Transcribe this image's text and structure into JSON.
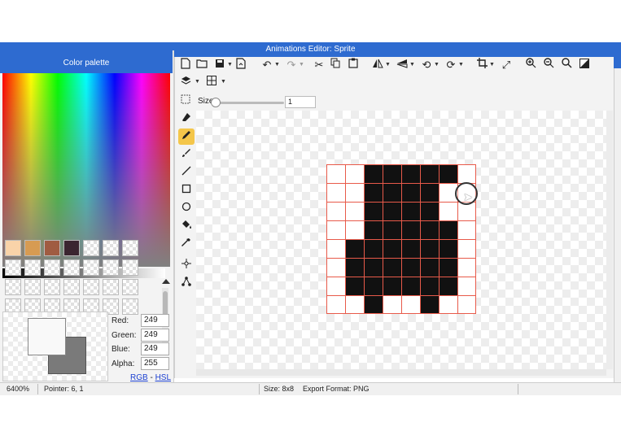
{
  "window": {
    "title": "Animations Editor: Sprite"
  },
  "palette": {
    "title": "Color palette",
    "swatch_colors": [
      "#f9d3a9",
      "#d79b52",
      "#a05c42",
      "#3b2530"
    ]
  },
  "color_values": {
    "red_label": "Red:",
    "red": "249",
    "green_label": "Green:",
    "green": "249",
    "blue_label": "Blue:",
    "blue": "249",
    "alpha_label": "Alpha:",
    "alpha": "255",
    "mode_rgb": "RGB",
    "mode_sep": " - ",
    "mode_hsl": "HSL"
  },
  "toolbar": {
    "icons_row1": [
      "new-file-icon",
      "open-folder-icon",
      "save-icon",
      "export-icon",
      "undo-icon",
      "redo-icon",
      "cut-icon",
      "copy-icon",
      "paste-icon",
      "flip-horizontal-icon",
      "flip-vertical-icon",
      "rotate-left-icon",
      "rotate-right-icon",
      "crop-icon",
      "resize-icon",
      "zoom-in-icon",
      "zoom-out-icon",
      "zoom-fit-icon",
      "invert-icon"
    ],
    "icons_row2": [
      "layers-icon",
      "grid-icon"
    ],
    "size_label": "Size",
    "size_value": "1"
  },
  "tools": [
    "select-tool-icon",
    "eraser-icon",
    "pencil-icon",
    "brush-icon",
    "line-icon",
    "rectangle-icon",
    "ellipse-icon",
    "fill-bucket-icon",
    "eyedropper-icon",
    "move-point-icon",
    "node-tool-icon"
  ],
  "sprite": {
    "width": 8,
    "height": 8,
    "pixels": [
      [
        0,
        0,
        1,
        1,
        1,
        1,
        1,
        0
      ],
      [
        0,
        0,
        1,
        1,
        1,
        1,
        0,
        0
      ],
      [
        0,
        0,
        1,
        1,
        1,
        1,
        0,
        0
      ],
      [
        0,
        0,
        1,
        1,
        1,
        1,
        1,
        0
      ],
      [
        0,
        1,
        1,
        1,
        1,
        1,
        1,
        0
      ],
      [
        0,
        1,
        1,
        1,
        1,
        1,
        1,
        0
      ],
      [
        0,
        1,
        1,
        1,
        1,
        1,
        1,
        0
      ],
      [
        0,
        0,
        1,
        0,
        0,
        1,
        0,
        0
      ]
    ],
    "pixel_color": "#111111",
    "grid_color": "#e85a4a"
  },
  "status": {
    "zoom": "6400%",
    "pointer": "Pointer: 6, 1",
    "size": "Size: 8x8",
    "export_format": "Export Format: PNG"
  }
}
